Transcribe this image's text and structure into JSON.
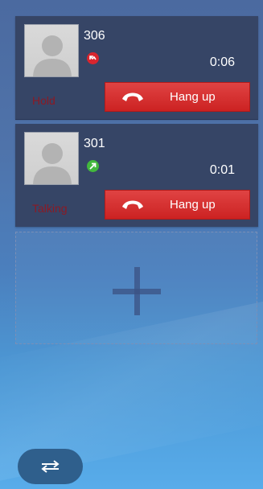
{
  "calls": [
    {
      "number": "306",
      "duration": "0:06",
      "state": "Hold",
      "status_icon": "call-hold-icon",
      "status_color": "#d8252e",
      "hangup_label": "Hang up"
    },
    {
      "number": "301",
      "duration": "0:01",
      "state": "Talking",
      "status_icon": "call-outgoing-icon",
      "status_color": "#43b83d",
      "hangup_label": "Hang up"
    }
  ],
  "add_call": {
    "icon": "plus-icon"
  },
  "switch_button": {
    "icon": "swap-arrows-icon"
  },
  "colors": {
    "card_bg": "#364566",
    "hangup_red": "#cc2222",
    "state_text": "#8b1a25"
  }
}
